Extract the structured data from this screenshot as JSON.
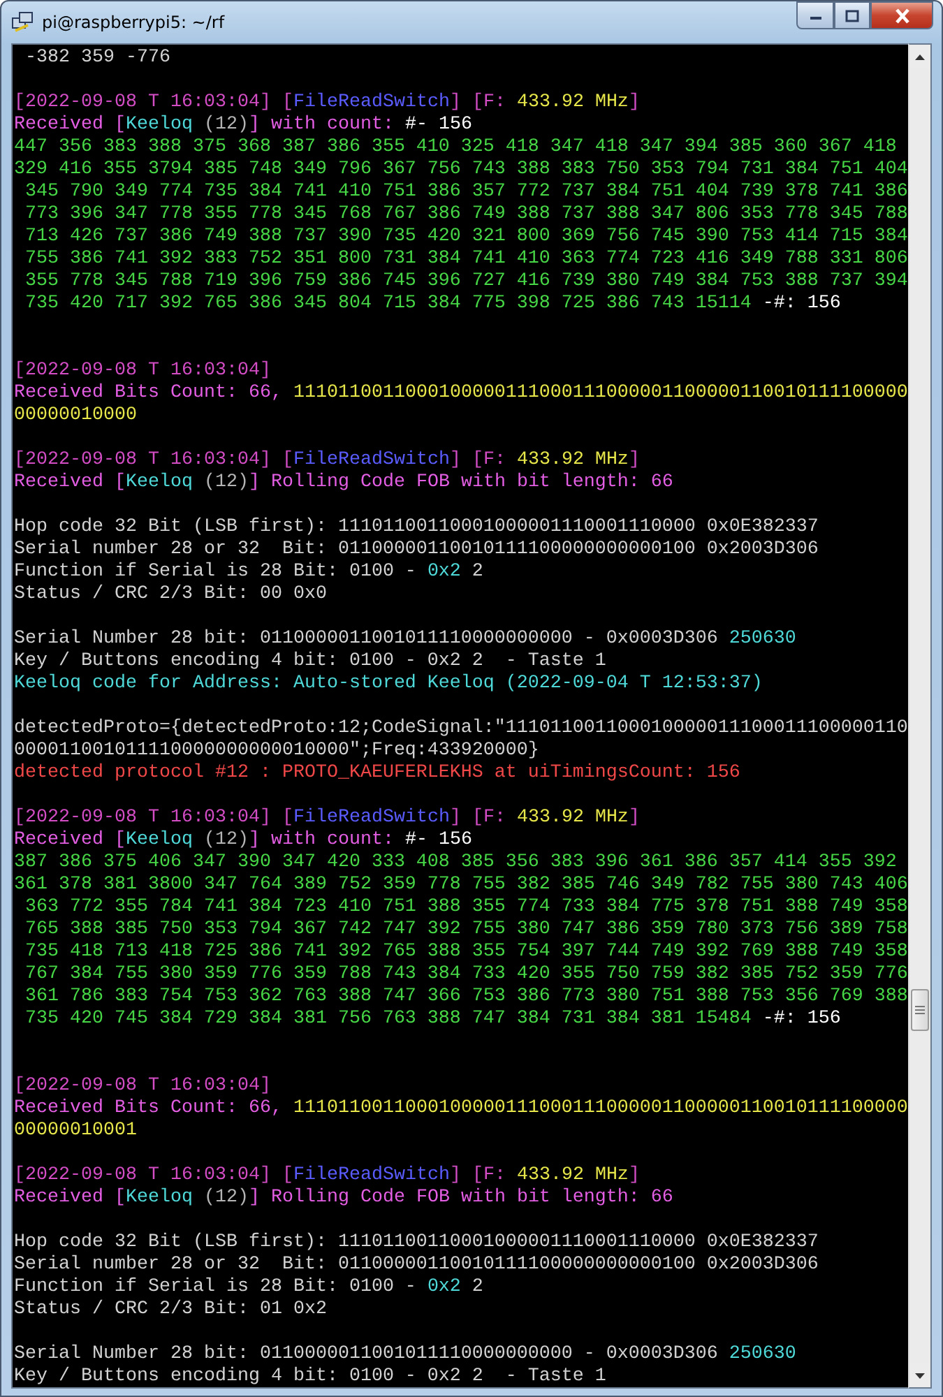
{
  "window": {
    "title": "pi@raspberrypi5: ~/rf"
  },
  "lines": [
    {
      "kind": "text",
      "segments": [
        {
          "text": " -382 359 -776",
          "color": "#d2d2d2"
        }
      ]
    },
    {
      "kind": "blank"
    },
    {
      "kind": "text",
      "segments": [
        {
          "text": "[2022-09-08 T 16:03:04] [",
          "color": "#d24cc4"
        },
        {
          "text": "FileReadSwitch",
          "color": "#5a5cff"
        },
        {
          "text": "] [F: ",
          "color": "#d24cc4"
        },
        {
          "text": "433.92 MHz",
          "color": "#e6e64a"
        },
        {
          "text": "]",
          "color": "#d24cc4"
        }
      ]
    },
    {
      "kind": "text",
      "segments": [
        {
          "text": "Received [",
          "color": "#e35ee3"
        },
        {
          "text": "Keeloq",
          "color": "#4fd8d8"
        },
        {
          "text": " (12)",
          "color": "#b4b4b4"
        },
        {
          "text": "] with count: ",
          "color": "#e35ee3"
        },
        {
          "text": "#- 156",
          "color": "#ffffff"
        }
      ]
    },
    {
      "kind": "text",
      "segments": [
        {
          "text": "447 356 383 388 375 368 387 386 355 410 325 418 347 418 347 394 385 360 367 418",
          "color": "#46d646"
        }
      ]
    },
    {
      "kind": "text",
      "segments": [
        {
          "text": "329 416 355 3794 385 748 349 796 367 756 743 388 383 750 353 794 731 384 751 404",
          "color": "#46d646"
        }
      ]
    },
    {
      "kind": "text",
      "segments": [
        {
          "text": " 345 790 349 774 735 384 741 410 751 386 357 772 737 384 751 404 739 378 741 386",
          "color": "#46d646"
        }
      ]
    },
    {
      "kind": "text",
      "segments": [
        {
          "text": " 773 396 347 778 355 778 345 768 767 386 749 388 737 388 347 806 353 778 345 788",
          "color": "#46d646"
        }
      ]
    },
    {
      "kind": "text",
      "segments": [
        {
          "text": " 713 426 737 386 749 388 737 390 735 420 321 800 369 756 745 390 753 414 715 384",
          "color": "#46d646"
        }
      ]
    },
    {
      "kind": "text",
      "segments": [
        {
          "text": " 755 386 741 392 383 752 351 800 731 384 741 410 363 774 723 416 349 788 331 806",
          "color": "#46d646"
        }
      ]
    },
    {
      "kind": "text",
      "segments": [
        {
          "text": " 355 778 345 788 719 396 759 386 745 396 727 416 739 380 749 384 753 388 737 394",
          "color": "#46d646"
        }
      ]
    },
    {
      "kind": "text",
      "segments": [
        {
          "text": " 735 420 717 392 765 386 345 804 715 384 775 398 725 386 743 15114",
          "color": "#46d646"
        },
        {
          "text": " -#: 156",
          "color": "#ffffff"
        }
      ]
    },
    {
      "kind": "blank"
    },
    {
      "kind": "blank"
    },
    {
      "kind": "text",
      "segments": [
        {
          "text": "[2022-09-08 T 16:03:04]",
          "color": "#d24cc4"
        }
      ]
    },
    {
      "kind": "text",
      "segments": [
        {
          "text": "Received Bits Count: 66, ",
          "color": "#e35ee3"
        },
        {
          "text": "1110110011000100000111000111000001100000110010111100000",
          "color": "#e6e64a"
        }
      ]
    },
    {
      "kind": "text",
      "segments": [
        {
          "text": "00000010000",
          "color": "#e6e64a"
        }
      ]
    },
    {
      "kind": "blank"
    },
    {
      "kind": "text",
      "segments": [
        {
          "text": "[2022-09-08 T 16:03:04] [",
          "color": "#d24cc4"
        },
        {
          "text": "FileReadSwitch",
          "color": "#5a5cff"
        },
        {
          "text": "] [F: ",
          "color": "#d24cc4"
        },
        {
          "text": "433.92 MHz",
          "color": "#e6e64a"
        },
        {
          "text": "]",
          "color": "#d24cc4"
        }
      ]
    },
    {
      "kind": "text",
      "segments": [
        {
          "text": "Received [",
          "color": "#e35ee3"
        },
        {
          "text": "Keeloq",
          "color": "#4fd8d8"
        },
        {
          "text": " (12)",
          "color": "#b4b4b4"
        },
        {
          "text": "] Rolling Code FOB with bit length: 66",
          "color": "#e35ee3"
        }
      ]
    },
    {
      "kind": "blank"
    },
    {
      "kind": "text",
      "segments": [
        {
          "text": "Hop code 32 Bit (LSB first): 11101100110001000001110001110000 0x0E382337",
          "color": "#d2d2d2"
        }
      ]
    },
    {
      "kind": "text",
      "segments": [
        {
          "text": "Serial number 28 or 32  Bit: 01100000110010111100000000000100 0x2003D306",
          "color": "#d2d2d2"
        }
      ]
    },
    {
      "kind": "text",
      "segments": [
        {
          "text": "Function if Serial is 28 Bit: 0100 - ",
          "color": "#d2d2d2"
        },
        {
          "text": "0x2",
          "color": "#4fd8d8"
        },
        {
          "text": " 2",
          "color": "#d2d2d2"
        }
      ]
    },
    {
      "kind": "text",
      "segments": [
        {
          "text": "Status / CRC 2/3 Bit: 00 0x0",
          "color": "#d2d2d2"
        }
      ]
    },
    {
      "kind": "blank"
    },
    {
      "kind": "text",
      "segments": [
        {
          "text": "Serial Number 28 bit: 0110000011001011110000000000 - 0x0003D306 ",
          "color": "#d2d2d2"
        },
        {
          "text": "250630",
          "color": "#4fd8d8"
        }
      ]
    },
    {
      "kind": "text",
      "segments": [
        {
          "text": "Key / Buttons encoding 4 bit: 0100 - 0x2 2  - Taste 1",
          "color": "#d2d2d2"
        }
      ]
    },
    {
      "kind": "text",
      "segments": [
        {
          "text": "Keeloq code for Address: Auto-stored Keeloq (2022-09-04 T 12:53:37)",
          "color": "#4fd8d8"
        }
      ]
    },
    {
      "kind": "blank"
    },
    {
      "kind": "text",
      "segments": [
        {
          "text": "detectedProto={detectedProto:12;CodeSignal:\"111011001100010000011100011100000110",
          "color": "#d2d2d2"
        }
      ]
    },
    {
      "kind": "text",
      "segments": [
        {
          "text": "000011001011110000000000010000\";Freq:433920000}",
          "color": "#d2d2d2"
        }
      ]
    },
    {
      "kind": "text",
      "segments": [
        {
          "text": "detected protocol #12 : PROTO_KAEUFERLEKHS at uiTimingsCount: 156",
          "color": "#f04848"
        }
      ]
    },
    {
      "kind": "blank"
    },
    {
      "kind": "text",
      "segments": [
        {
          "text": "[2022-09-08 T 16:03:04] [",
          "color": "#d24cc4"
        },
        {
          "text": "FileReadSwitch",
          "color": "#5a5cff"
        },
        {
          "text": "] [F: ",
          "color": "#d24cc4"
        },
        {
          "text": "433.92 MHz",
          "color": "#e6e64a"
        },
        {
          "text": "]",
          "color": "#d24cc4"
        }
      ]
    },
    {
      "kind": "text",
      "segments": [
        {
          "text": "Received [",
          "color": "#e35ee3"
        },
        {
          "text": "Keeloq",
          "color": "#4fd8d8"
        },
        {
          "text": " (12)",
          "color": "#b4b4b4"
        },
        {
          "text": "] with count: ",
          "color": "#e35ee3"
        },
        {
          "text": "#- 156",
          "color": "#ffffff"
        }
      ]
    },
    {
      "kind": "text",
      "segments": [
        {
          "text": "387 386 375 406 347 390 347 420 333 408 385 356 383 396 361 386 357 414 355 392",
          "color": "#46d646"
        }
      ]
    },
    {
      "kind": "text",
      "segments": [
        {
          "text": "361 378 381 3800 347 764 389 752 359 778 755 382 385 746 349 782 755 380 743 406",
          "color": "#46d646"
        }
      ]
    },
    {
      "kind": "text",
      "segments": [
        {
          "text": " 363 772 355 784 741 384 723 410 751 388 355 774 733 384 775 378 751 388 749 358",
          "color": "#46d646"
        }
      ]
    },
    {
      "kind": "text",
      "segments": [
        {
          "text": " 765 388 385 750 353 794 367 742 747 392 755 380 747 386 359 780 373 756 389 758",
          "color": "#46d646"
        }
      ]
    },
    {
      "kind": "text",
      "segments": [
        {
          "text": " 735 418 713 418 725 386 741 392 765 388 355 754 397 744 749 392 769 388 749 358",
          "color": "#46d646"
        }
      ]
    },
    {
      "kind": "text",
      "segments": [
        {
          "text": " 767 384 755 380 359 776 359 788 743 384 733 420 355 750 759 382 385 752 359 776",
          "color": "#46d646"
        }
      ]
    },
    {
      "kind": "text",
      "segments": [
        {
          "text": " 361 786 383 754 753 362 763 388 747 366 753 386 773 380 751 388 753 356 769 388",
          "color": "#46d646"
        }
      ]
    },
    {
      "kind": "text",
      "segments": [
        {
          "text": " 735 420 745 384 729 384 381 756 763 388 747 384 731 384 381 15484",
          "color": "#46d646"
        },
        {
          "text": " -#: 156",
          "color": "#ffffff"
        }
      ]
    },
    {
      "kind": "blank"
    },
    {
      "kind": "blank"
    },
    {
      "kind": "text",
      "segments": [
        {
          "text": "[2022-09-08 T 16:03:04]",
          "color": "#d24cc4"
        }
      ]
    },
    {
      "kind": "text",
      "segments": [
        {
          "text": "Received Bits Count: 66, ",
          "color": "#e35ee3"
        },
        {
          "text": "1110110011000100000111000111000001100000110010111100000",
          "color": "#e6e64a"
        }
      ]
    },
    {
      "kind": "text",
      "segments": [
        {
          "text": "00000010001",
          "color": "#e6e64a"
        }
      ]
    },
    {
      "kind": "blank"
    },
    {
      "kind": "text",
      "segments": [
        {
          "text": "[2022-09-08 T 16:03:04] [",
          "color": "#d24cc4"
        },
        {
          "text": "FileReadSwitch",
          "color": "#5a5cff"
        },
        {
          "text": "] [F: ",
          "color": "#d24cc4"
        },
        {
          "text": "433.92 MHz",
          "color": "#e6e64a"
        },
        {
          "text": "]",
          "color": "#d24cc4"
        }
      ]
    },
    {
      "kind": "text",
      "segments": [
        {
          "text": "Received [",
          "color": "#e35ee3"
        },
        {
          "text": "Keeloq",
          "color": "#4fd8d8"
        },
        {
          "text": " (12)",
          "color": "#b4b4b4"
        },
        {
          "text": "] Rolling Code FOB with bit length: 66",
          "color": "#e35ee3"
        }
      ]
    },
    {
      "kind": "blank"
    },
    {
      "kind": "text",
      "segments": [
        {
          "text": "Hop code 32 Bit (LSB first): 11101100110001000001110001110000 0x0E382337",
          "color": "#d2d2d2"
        }
      ]
    },
    {
      "kind": "text",
      "segments": [
        {
          "text": "Serial number 28 or 32  Bit: 01100000110010111100000000000100 0x2003D306",
          "color": "#d2d2d2"
        }
      ]
    },
    {
      "kind": "text",
      "segments": [
        {
          "text": "Function if Serial is 28 Bit: 0100 - ",
          "color": "#d2d2d2"
        },
        {
          "text": "0x2",
          "color": "#4fd8d8"
        },
        {
          "text": " 2",
          "color": "#d2d2d2"
        }
      ]
    },
    {
      "kind": "text",
      "segments": [
        {
          "text": "Status / CRC 2/3 Bit: 01 0x2",
          "color": "#d2d2d2"
        }
      ]
    },
    {
      "kind": "blank"
    },
    {
      "kind": "text",
      "segments": [
        {
          "text": "Serial Number 28 bit: 0110000011001011110000000000 - 0x0003D306 ",
          "color": "#d2d2d2"
        },
        {
          "text": "250630",
          "color": "#4fd8d8"
        }
      ]
    },
    {
      "kind": "text",
      "segments": [
        {
          "text": "Key / Buttons encoding 4 bit: 0100 - 0x2 2  - Taste 1",
          "color": "#d2d2d2"
        }
      ]
    }
  ]
}
